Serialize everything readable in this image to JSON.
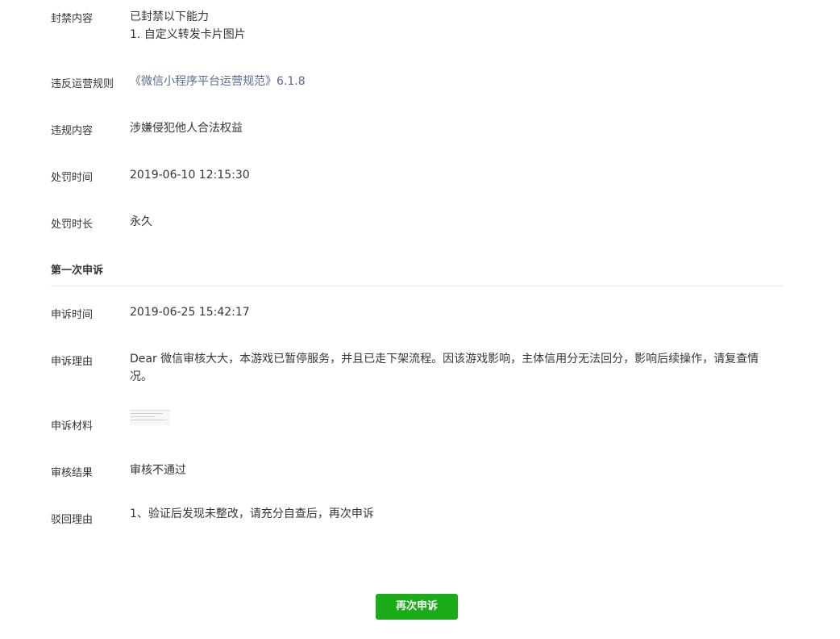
{
  "ban": {
    "content_label": "封禁内容",
    "content_line1": "已封禁以下能力",
    "content_line2": "1. 自定义转发卡片图片",
    "rule_label": "违反运营规则",
    "rule_link": "《微信小程序平台运营规范》6.1.8",
    "violation_label": "违规内容",
    "violation_value": "涉嫌侵犯他人合法权益",
    "time_label": "处罚时间",
    "time_value": "2019-06-10 12:15:30",
    "duration_label": "处罚时长",
    "duration_value": "永久"
  },
  "appeal": {
    "section_title": "第一次申诉",
    "time_label": "申诉时间",
    "time_value": "2019-06-25 15:42:17",
    "reason_label": "申诉理由",
    "reason_value": "Dear 微信审核大大，本游戏已暂停服务，并且已走下架流程。因该游戏影响，主体信用分无法回分，影响后续操作，请复查情况。",
    "material_label": "申诉材料",
    "result_label": "审核结果",
    "result_value": "审核不通过",
    "reject_label": "驳回理由",
    "reject_value": "1、验证后发现未整改，请充分自查后，再次申诉"
  },
  "actions": {
    "reappeal_label": "再次申诉"
  },
  "colors": {
    "link": "#576b95",
    "button": "#1aad19",
    "divider": "#e7e7eb",
    "text": "#353535"
  }
}
